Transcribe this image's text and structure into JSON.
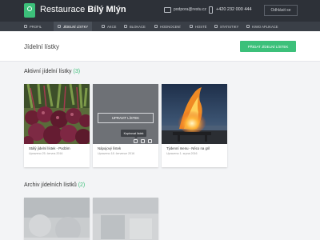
{
  "header": {
    "brand_prefix": "Restaurace",
    "brand_name": "Bílý Mlýn",
    "email": "podpora@restu.cz",
    "phone": "+420 232 000 444",
    "logout_label": "Odhlásit se"
  },
  "nav": {
    "items": [
      {
        "label": "PROFIL",
        "icon": "user-icon"
      },
      {
        "label": "JÍDELNÍ LÍSTKY",
        "icon": "menu-list-icon",
        "active": true
      },
      {
        "label": "AKCE",
        "icon": "star-icon"
      },
      {
        "label": "BLOKACE",
        "icon": "lock-icon"
      },
      {
        "label": "HODNOCENÍ",
        "icon": "chat-icon"
      },
      {
        "label": "HOSTÉ",
        "icon": "guests-icon"
      },
      {
        "label": "STATISTIKY",
        "icon": "chart-icon"
      },
      {
        "label": "KIWO APLIKACE",
        "icon": "app-icon"
      }
    ]
  },
  "page": {
    "title": "Jídelní lístky",
    "add_button": "PŘIDAT JÍDELNÍ LÍSTEK"
  },
  "active_section": {
    "title": "Aktivní jídelní lístky",
    "count": "(3)",
    "cards": [
      {
        "title": "Stálý jídelní lístek - Podzim",
        "subtitle": "Upraveno 25. června 2016"
      },
      {
        "title": "Nápojový lístek",
        "subtitle": "Upraveno 18. července 2016",
        "edit_label": "UPRAVIT LÍSTEK",
        "tooltip": "Kopírovat lístek"
      },
      {
        "title": "Týdenní menu - Něco na gril",
        "subtitle": "Upraveno 1. srpna 2016"
      }
    ]
  },
  "archive_section": {
    "title": "Archiv jídelních lístků",
    "count": "(2)"
  },
  "colors": {
    "accent": "#3cc07a",
    "topbar": "#2d3138",
    "navbar": "#3a3f47"
  }
}
